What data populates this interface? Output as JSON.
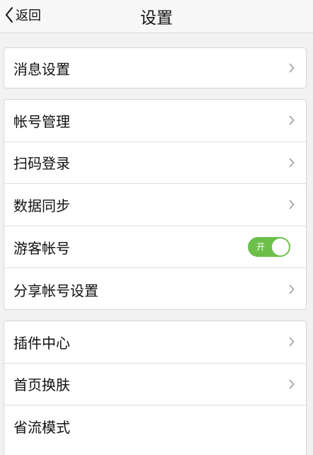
{
  "nav": {
    "back_label": "返回",
    "title": "设置"
  },
  "colors": {
    "toggle_on": "#6cc04a",
    "background": "#f2f2f2",
    "chevron": "#9a9a9a"
  },
  "groups": [
    {
      "items": [
        {
          "label": "消息设置",
          "accessory": "chevron-right-icon"
        }
      ]
    },
    {
      "items": [
        {
          "label": "帐号管理",
          "accessory": "chevron-right-icon"
        },
        {
          "label": "扫码登录",
          "accessory": "chevron-right-icon"
        },
        {
          "label": "数据同步",
          "accessory": "chevron-right-icon"
        },
        {
          "label": "游客帐号",
          "accessory": "toggle",
          "toggle_text": "开",
          "toggle_on": true
        },
        {
          "label": "分享帐号设置",
          "accessory": "chevron-right-icon"
        }
      ]
    },
    {
      "items": [
        {
          "label": "插件中心",
          "accessory": "chevron-right-icon"
        },
        {
          "label": "首页换肤",
          "accessory": "chevron-right-icon"
        },
        {
          "label": "省流模式",
          "accessory": "none"
        }
      ]
    }
  ]
}
